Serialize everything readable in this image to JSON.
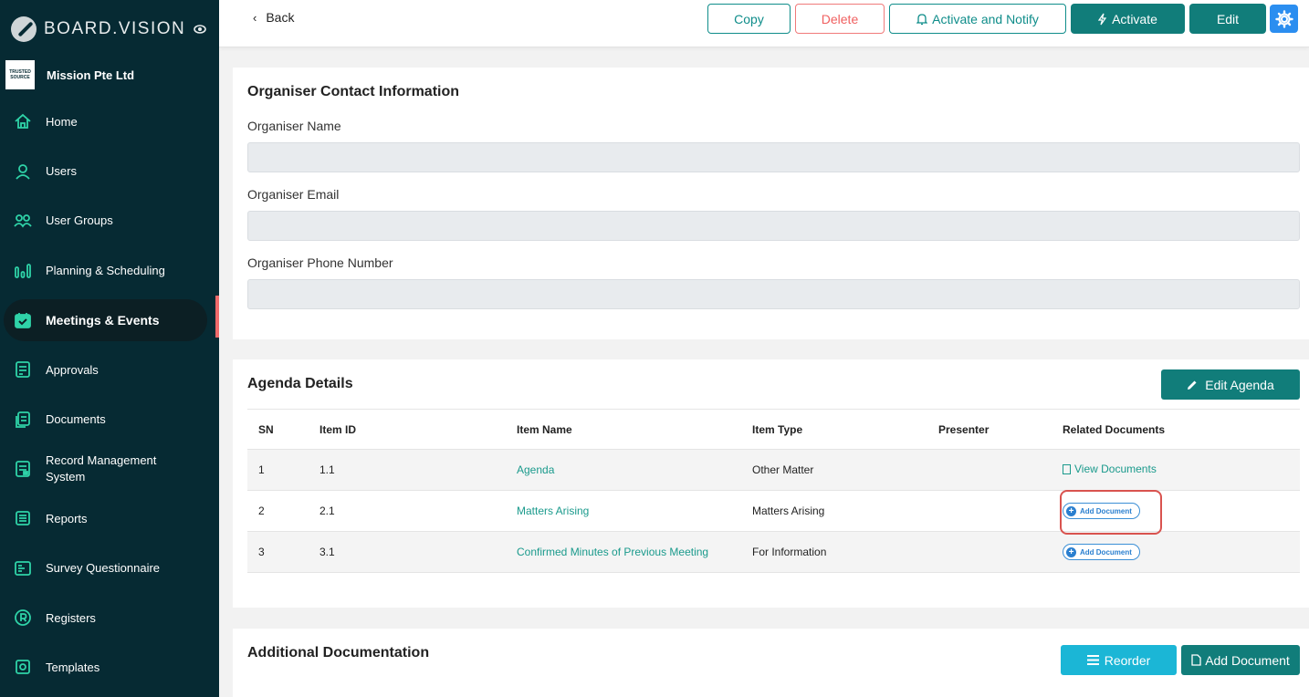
{
  "sidebar": {
    "brand": "BOARD.VISION",
    "org_logo_text": "TRUSTED SOURCE",
    "org_name": "Mission Pte Ltd",
    "items": [
      {
        "label": "Home",
        "icon": "home-icon"
      },
      {
        "label": "Users",
        "icon": "user-icon"
      },
      {
        "label": "User Groups",
        "icon": "user-group-icon"
      },
      {
        "label": "Planning & Scheduling",
        "icon": "bars-icon"
      },
      {
        "label": "Meetings & Events",
        "icon": "calendar-icon",
        "active": true
      },
      {
        "label": "Approvals",
        "icon": "approval-icon"
      },
      {
        "label": "Documents",
        "icon": "documents-icon"
      },
      {
        "label": "Record Management System",
        "icon": "record-icon"
      },
      {
        "label": "Reports",
        "icon": "reports-icon"
      },
      {
        "label": "Survey Questionnaire",
        "icon": "survey-icon"
      },
      {
        "label": "Registers",
        "icon": "registers-icon"
      },
      {
        "label": "Templates",
        "icon": "templates-icon"
      }
    ]
  },
  "topbar": {
    "back_label": "Back",
    "copy_label": "Copy",
    "delete_label": "Delete",
    "notify_label": "Activate and Notify",
    "activate_label": "Activate",
    "edit_label": "Edit"
  },
  "organiser": {
    "title": "Organiser Contact Information",
    "name_label": "Organiser Name",
    "name_value": "",
    "email_label": "Organiser Email",
    "email_value": "",
    "phone_label": "Organiser Phone Number",
    "phone_value": ""
  },
  "agenda": {
    "title": "Agenda Details",
    "edit_label": "Edit Agenda",
    "columns": [
      "SN",
      "Item ID",
      "Item Name",
      "Item Type",
      "Presenter",
      "Related Documents"
    ],
    "rows": [
      {
        "sn": "1",
        "id": "1.1",
        "name": "Agenda",
        "type": "Other Matter",
        "presenter": "",
        "docs": "View Documents"
      },
      {
        "sn": "2",
        "id": "2.1",
        "name": "Matters Arising",
        "type": "Matters Arising",
        "presenter": "",
        "docs": "Add Document"
      },
      {
        "sn": "3",
        "id": "3.1",
        "name": "Confirmed Minutes of Previous Meeting",
        "type": "For Information",
        "presenter": "",
        "docs": "Add Document"
      }
    ]
  },
  "additional": {
    "title": "Additional Documentation",
    "reorder_label": "Reorder",
    "add_document_label": "Add Document"
  },
  "colors": {
    "sidebar_bg": "#062a33",
    "accent_teal": "#117d7a",
    "icon_green": "#2fd3a8",
    "link_teal": "#1a9a8c",
    "danger": "#f06060",
    "highlight": "#d9534f",
    "reorder_cyan": "#1bb6d6"
  }
}
